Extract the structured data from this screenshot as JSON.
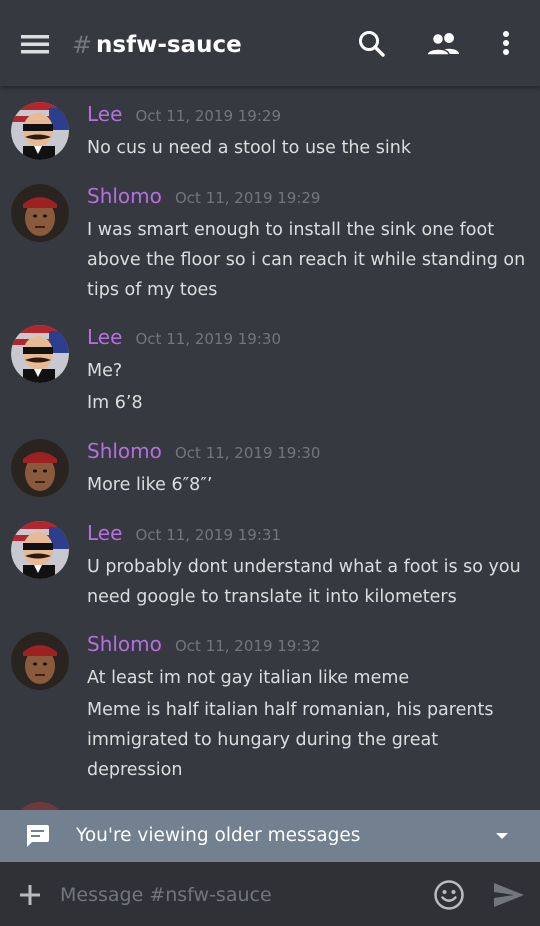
{
  "header": {
    "channel_hash": "#",
    "channel_name": "nsfw-sauce",
    "icons": [
      "menu-icon",
      "search-icon",
      "members-icon",
      "more-vertical-icon"
    ]
  },
  "messages": [
    {
      "author": "Lee",
      "time": "Oct 11, 2019 19:29",
      "lines": [
        "No cus u need a stool to use the sink"
      ]
    },
    {
      "author": "Shlomo",
      "time": "Oct 11, 2019 19:29",
      "lines": [
        "I was smart enough to install the sink one foot",
        "above the floor so i can reach it while standing on",
        "tips of my toes"
      ]
    },
    {
      "author": "Lee",
      "time": "Oct 11, 2019 19:30",
      "lines": [
        "Me?",
        "Im 6’8"
      ]
    },
    {
      "author": "Shlomo",
      "time": "Oct 11, 2019 19:30",
      "lines": [
        "More like 6″8″’"
      ]
    },
    {
      "author": "Lee",
      "time": "Oct 11, 2019 19:31",
      "lines": [
        "U probably dont understand what a foot is so you",
        "need google to translate it into kilometers"
      ]
    },
    {
      "author": "Shlomo",
      "time": "Oct 11, 2019 19:32",
      "lines": [
        "At least im not gay italian like meme",
        "Meme is half italian half romanian, his parents",
        "immigrated to hungary during the great",
        "depression"
      ]
    }
  ],
  "older_bar": {
    "text": "You're viewing older messages",
    "icon": "chat-bubble-icon"
  },
  "composer": {
    "placeholder": "Message #nsfw-sauce"
  },
  "colors": {
    "background": "#36393f",
    "author": "#b66ee0",
    "timestamp": "#72767d",
    "older_bar": "#72808f",
    "composer": "#2f3136"
  }
}
